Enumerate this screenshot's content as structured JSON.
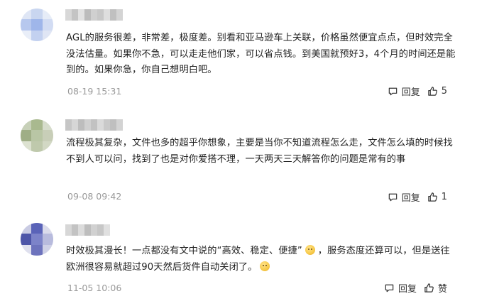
{
  "comments": [
    {
      "text_parts": [
        "AGL的服务很差，非常差，极度差。别看和亚马逊车上关联，价格虽然便宜点点，但时效完全没法估量。如果你不急，可以走走他们家，可以省点钱。到美国就预好3，4个月的时间还是能到的。如果你急，你自己想明白吧。"
      ],
      "date": "08-19 15:31",
      "reply_label": "回复",
      "like_label": "5"
    },
    {
      "text_parts": [
        "流程极其复杂，文件也多的超乎你想象，主要是当你不知道流程怎么走，文件怎么填的时候找不到人可以问，找到了也是对你爱搭不理，一天两天三天解答你的问题是常有的事"
      ],
      "date": "09-08 09:42",
      "reply_label": "回复",
      "like_label": "1"
    },
    {
      "text_parts": [
        "时效极其漫长！一点都没有文中说的“高效、稳定、便捷”",
        "，服务态度还算可以，但是送往欧洲很容易就超过90天然后货件自动关闭了。"
      ],
      "date": "11-05 10:06",
      "reply_label": "回复",
      "like_label": "赞"
    }
  ],
  "colors": {
    "meta": "#999999",
    "text": "#222222"
  }
}
